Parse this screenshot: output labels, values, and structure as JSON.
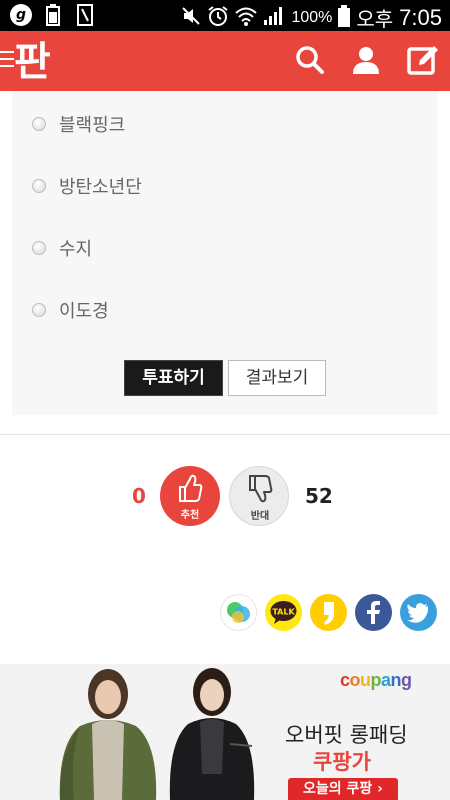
{
  "status_bar": {
    "battery_percent": "100%",
    "ampm": "오후",
    "time": "7:05",
    "icons": [
      "g-app-icon",
      "battery-small-icon",
      "phone-outline-icon",
      "mute-icon",
      "alarm-icon",
      "wifi-icon",
      "signal-icon",
      "battery-icon"
    ]
  },
  "app_bar": {
    "logo_text": "판",
    "accent_color": "#e8453c",
    "icons": [
      "menu-icon",
      "search-icon",
      "user-icon",
      "write-icon"
    ]
  },
  "poll": {
    "options": [
      {
        "label": "블랙핑크"
      },
      {
        "label": "방탄소년단"
      },
      {
        "label": "수지"
      },
      {
        "label": "이도경"
      }
    ],
    "vote_label": "투표하기",
    "result_label": "결과보기"
  },
  "reaction": {
    "recommend_count": "0",
    "recommend_label": "추천",
    "oppose_label": "반대",
    "oppose_count": "52"
  },
  "share": {
    "icons": [
      "band-icon",
      "kakaotalk-icon",
      "kakaostory-icon",
      "facebook-icon",
      "twitter-icon"
    ],
    "talk_text": "TALK"
  },
  "ad": {
    "brand": "coupang",
    "headline": "오버핏 롱패딩",
    "highlight": "쿠팡가",
    "cta": "오늘의 쿠팡 ›"
  }
}
